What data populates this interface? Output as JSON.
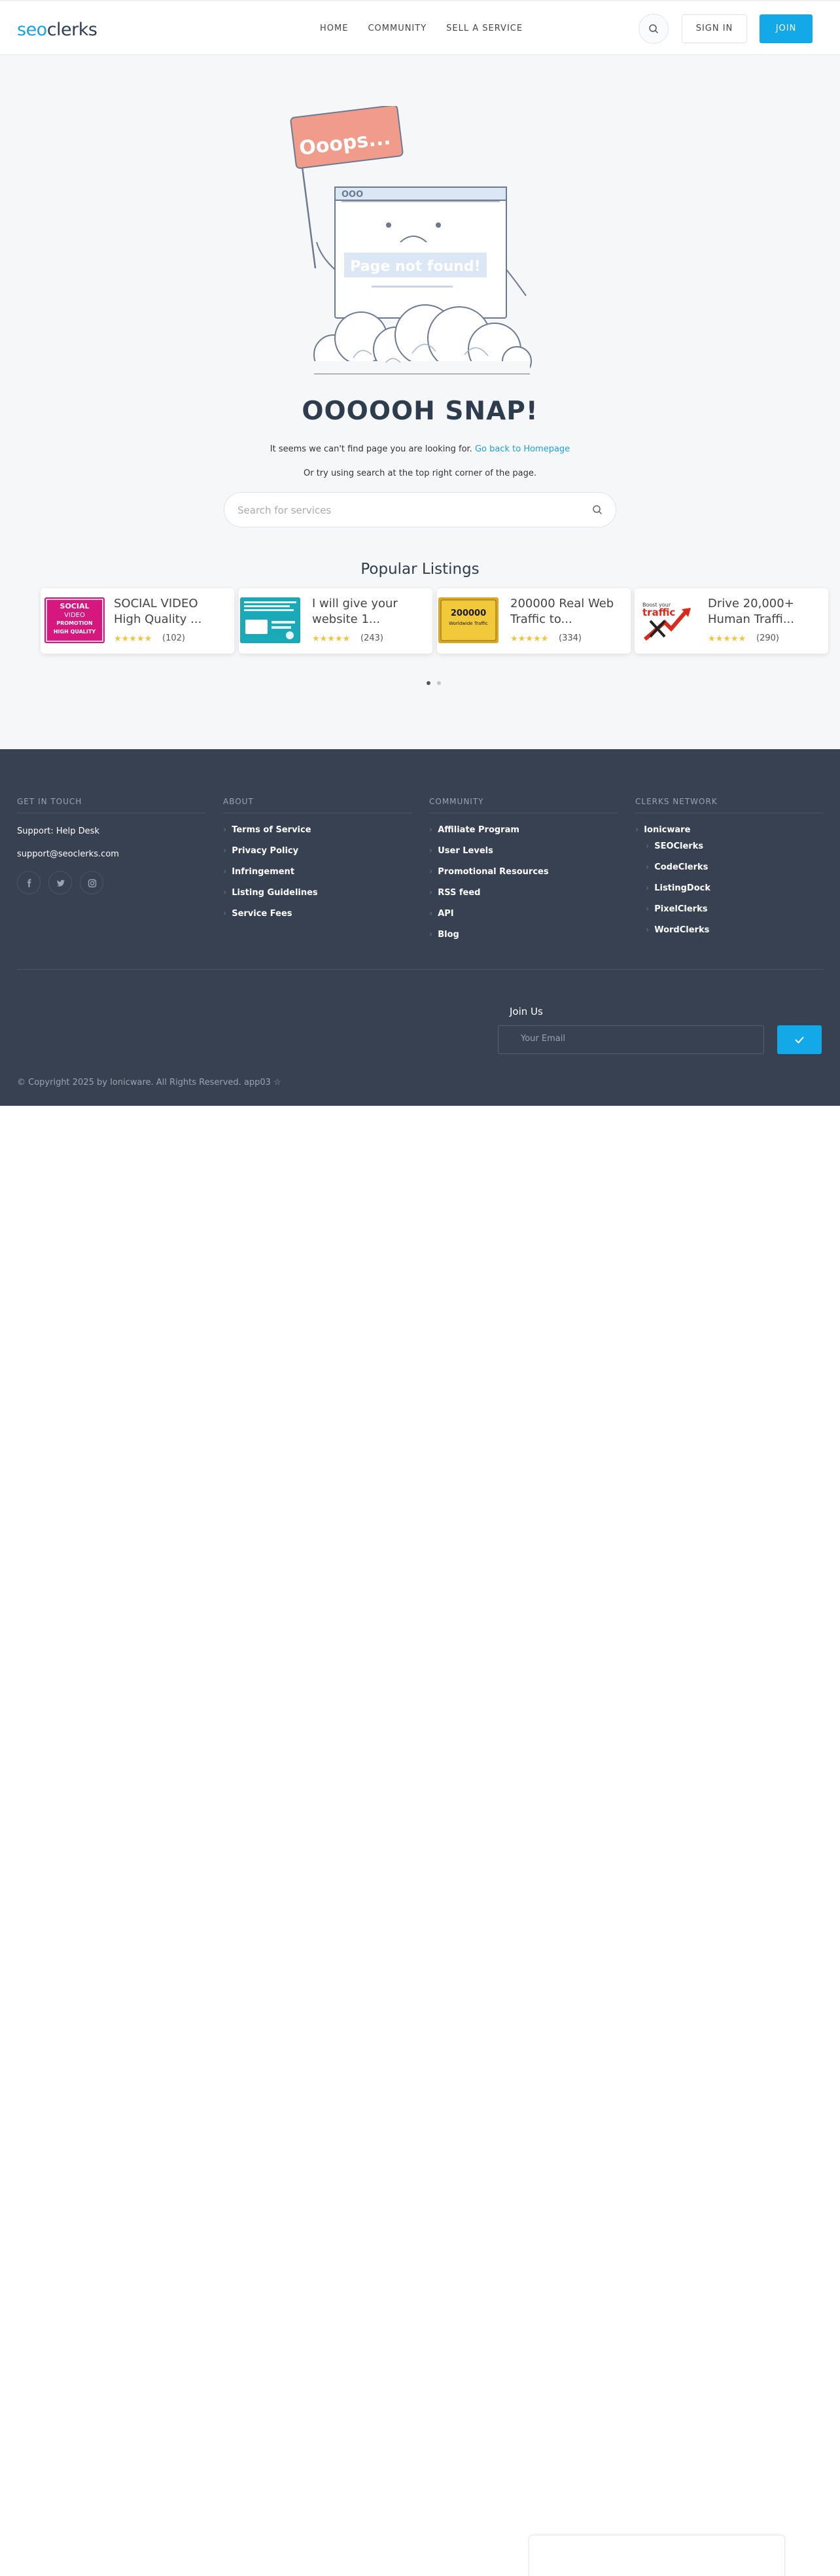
{
  "header": {
    "logo_part1": "seo",
    "logo_part2": "clerks",
    "nav": [
      "HOME",
      "COMMUNITY",
      "SELL A SERVICE"
    ],
    "signin": "SIGN IN",
    "join": "JOIN"
  },
  "illustration": {
    "flag_text": "Ooops...",
    "browser_dots": "OOO",
    "browser_text": "Page not found!"
  },
  "main": {
    "heading": "OOOOOH SNAP!",
    "seems_text": "It seems we can't find page you are looking for.",
    "homepage_link": "Go back to Homepage",
    "or_try": "Or try using search at the top right corner of the page.",
    "search_placeholder": "Search for services",
    "popular_title": "Popular Listings"
  },
  "listings": [
    {
      "title": "SOCIAL VIDEO High Quality ...",
      "stars": "★★★★★",
      "count": "(102)",
      "thumb_lines": [
        "SOCIAL",
        "VIDEO",
        "PROMOTION",
        "HIGH QUALITY"
      ]
    },
    {
      "title": "I will give your website 1...",
      "stars": "★★★★★",
      "count": "(243)",
      "thumb_lines": []
    },
    {
      "title": "200000 Real Web Traffic to...",
      "stars": "★★★★★",
      "count": "(334)",
      "thumb_lines": [
        "200000",
        "Worldwide Traffic"
      ]
    },
    {
      "title": "Drive 20,000+ Human Traffi...",
      "stars": "★★★★★",
      "count": "(290)",
      "thumb_lines": [
        "Boost your",
        "traffic"
      ]
    }
  ],
  "footer": {
    "get_in_touch": {
      "heading": "GET IN TOUCH",
      "support": "Support: Help Desk",
      "email": "support@seoclerks.com"
    },
    "about": {
      "heading": "ABOUT",
      "items": [
        "Terms of Service",
        "Privacy Policy",
        "Infringement",
        "Listing Guidelines",
        "Service Fees"
      ]
    },
    "community": {
      "heading": "COMMUNITY",
      "items": [
        "Affiliate Program",
        "User Levels",
        "Promotional Resources",
        "RSS feed",
        "API",
        "Blog"
      ]
    },
    "network": {
      "heading": "CLERKS NETWORK",
      "parent": "Ionicware",
      "items": [
        "SEOClerks",
        "CodeClerks",
        "ListingDock",
        "PixelClerks",
        "WordClerks"
      ]
    },
    "join_us": "Join Us",
    "email_placeholder": "Your Email",
    "copyright": "© Copyright 2025 by Ionicware. All Rights Reserved. app03 ☆"
  },
  "colors": {
    "accent": "#13a8e8",
    "footer_bg": "#374151",
    "heading": "#2d3d4d"
  }
}
